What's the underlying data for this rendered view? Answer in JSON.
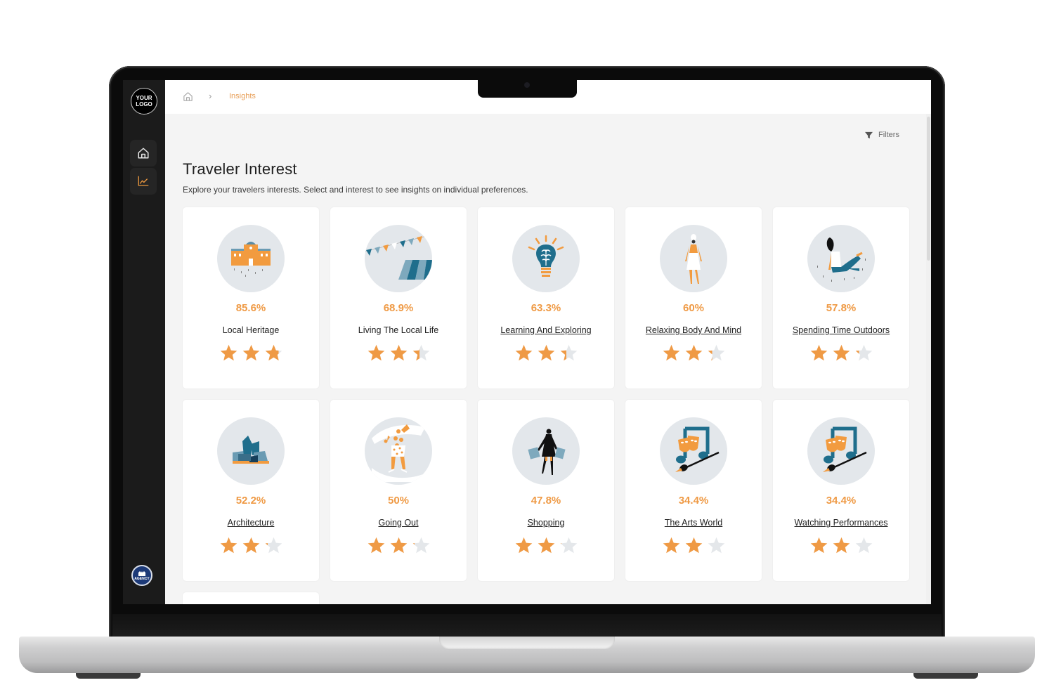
{
  "sidebar": {
    "logo_line1": "YOUR",
    "logo_line2": "LOGO",
    "nav": [
      {
        "name": "home",
        "icon": "home-icon",
        "active": false
      },
      {
        "name": "insights",
        "icon": "chart-line-icon",
        "active": true
      }
    ],
    "org_badge": "AGENCY"
  },
  "breadcrumb": {
    "home_icon": "home-icon",
    "separator": "›",
    "current": "Insights"
  },
  "toolbar": {
    "filters_label": "Filters",
    "filters_icon": "funnel-icon"
  },
  "page": {
    "title": "Traveler Interest",
    "subtitle": "Explore your travelers interests. Select and interest to see insights on individual preferences."
  },
  "colors": {
    "accent": "#ef9a45",
    "star_empty": "#e4e7ea",
    "teal": "#1f6e8c",
    "icon_bg": "#e3e7eb"
  },
  "interests": [
    {
      "percent": "85.6%",
      "label": "Local Heritage",
      "rating": 2.8,
      "link": false,
      "icon": "heritage-building-icon"
    },
    {
      "percent": "68.9%",
      "label": "Living The Local Life",
      "rating": 2.4,
      "link": false,
      "icon": "market-bunting-icon"
    },
    {
      "percent": "63.3%",
      "label": "Learning And Exploring",
      "rating": 2.35,
      "link": true,
      "icon": "brain-lightbulb-icon"
    },
    {
      "percent": "60%",
      "label": "Relaxing Body And Mind",
      "rating": 2.25,
      "link": true,
      "icon": "spa-woman-icon"
    },
    {
      "percent": "57.8%",
      "label": "Spending Time Outdoors",
      "rating": 2.2,
      "link": true,
      "icon": "outdoors-woman-icon"
    },
    {
      "percent": "52.2%",
      "label": "Architecture",
      "rating": 2.15,
      "link": true,
      "icon": "architecture-building-icon"
    },
    {
      "percent": "50%",
      "label": "Going Out",
      "rating": 2.1,
      "link": true,
      "icon": "dancing-party-icon"
    },
    {
      "percent": "47.8%",
      "label": "Shopping",
      "rating": 2.05,
      "link": true,
      "icon": "shopping-bags-icon"
    },
    {
      "percent": "34.4%",
      "label": "The Arts World",
      "rating": 2.0,
      "link": true,
      "icon": "arts-masks-music-icon"
    },
    {
      "percent": "34.4%",
      "label": "Watching Performances",
      "rating": 2.0,
      "link": true,
      "icon": "arts-masks-music-icon"
    }
  ]
}
